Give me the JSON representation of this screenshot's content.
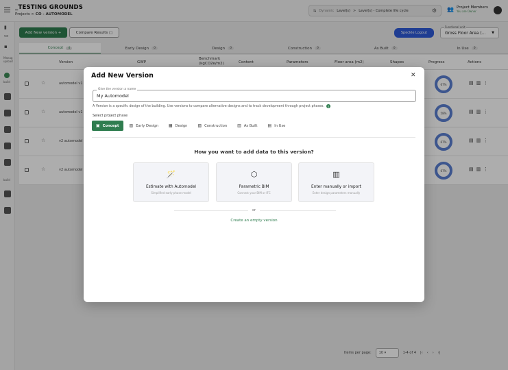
{
  "app": {
    "title": "_TESTING GROUNDS",
    "breadcrumb_root": "Projects",
    "breadcrumb_sep": ">",
    "breadcrumb_current": "CO - AUTOMODEL"
  },
  "phase_selector": {
    "level_prefix": "Dynamic",
    "level_a": "Level(s)",
    "sep": ">",
    "level_b": "Level(s) - Complete life cycle"
  },
  "members": {
    "label": "Project Members",
    "sub": "You are Owner"
  },
  "leftbar": {
    "label_a": "Manag upload",
    "label_b": "build",
    "label_c": "build"
  },
  "toolbar": {
    "add_version": "Add New version",
    "compare": "Compare Results",
    "speckle": "Speckle Logout",
    "functional_unit_label": "Functional unit",
    "functional_unit_value": "Gross Floor Area (..."
  },
  "tabs": [
    {
      "label": "Concept",
      "count": "4"
    },
    {
      "label": "Early Design",
      "count": "0"
    },
    {
      "label": "Design",
      "count": "0"
    },
    {
      "label": "Construction",
      "count": "0"
    },
    {
      "label": "As Built",
      "count": "0"
    },
    {
      "label": "In Use",
      "count": "0"
    }
  ],
  "table": {
    "headers": [
      "Version",
      "GWP",
      "Benchmark (kgCO2e/m2)",
      "Content",
      "Parameters",
      "Floor area (m2)",
      "Shapes",
      "Progress",
      "Actions"
    ],
    "rows": [
      {
        "name": "automodel v1",
        "progress": "67%"
      },
      {
        "name": "automodel v1",
        "progress": "58%"
      },
      {
        "name": "v2 automodel",
        "progress": "67%"
      },
      {
        "name": "v2 automodel",
        "progress": "67%"
      }
    ]
  },
  "pager": {
    "label": "Items per page:",
    "per_page": "10",
    "range": "1-4 of 4"
  },
  "modal": {
    "title": "Add New Version",
    "name_label": "Give the version a name",
    "name_value": "My Automodel",
    "help": "A Version is a specific design of the building. Use versions to compare alternative designs and to track development through project phases.",
    "phase_label": "Select project phase",
    "phases": [
      "Concept",
      "Early Design",
      "Design",
      "Construction",
      "As Built",
      "In Use"
    ],
    "question": "How you want to add data to this version?",
    "options": [
      {
        "title": "Estimate with Automodel",
        "subtitle": "Simplified early-phase model",
        "icon": "magic-wand-icon"
      },
      {
        "title": "Parametric BIM",
        "subtitle": "Connect your BIM or IFC",
        "icon": "cube-icon"
      },
      {
        "title": "Enter manually or import",
        "subtitle": "Enter design parameters manually",
        "icon": "manual-entry-icon"
      }
    ],
    "or": "or",
    "empty": "Create an empty version"
  },
  "colors": {
    "accent": "#2f7d4f",
    "speckle": "#2e5bd8",
    "progress": "#5b7fd1"
  }
}
